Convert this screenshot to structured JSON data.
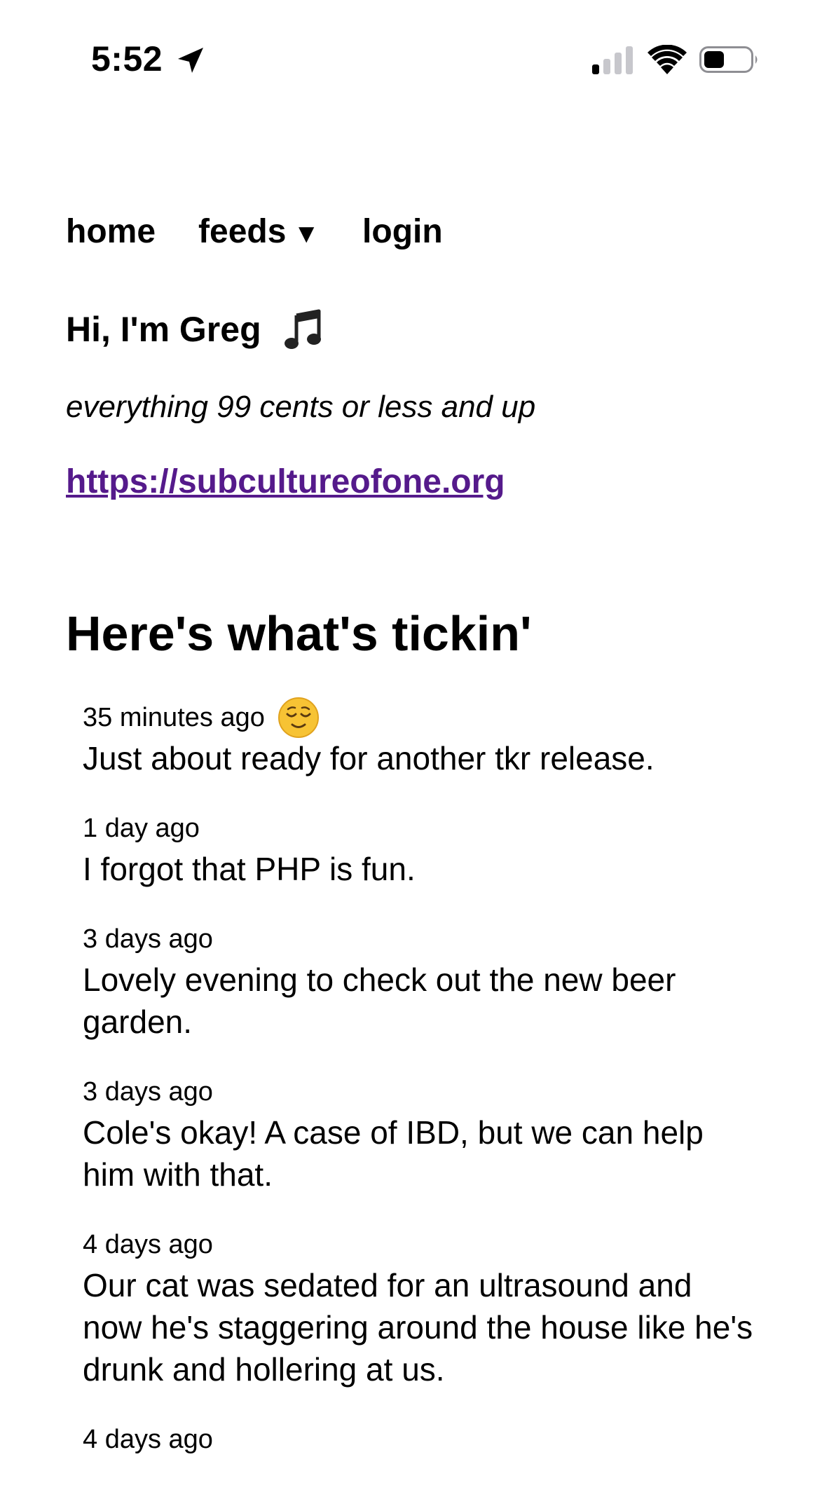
{
  "status_bar": {
    "time": "5:52",
    "icons": [
      "location-arrow-icon",
      "cellular-signal-icon",
      "wifi-icon",
      "battery-icon"
    ]
  },
  "nav": {
    "home": "home",
    "feeds": "feeds",
    "feeds_caret": "▼",
    "login": "login"
  },
  "profile": {
    "greeting": "Hi, I'm Greg",
    "greeting_icon": "music-note-icon",
    "tagline": "everything 99 cents or less and up",
    "homepage": "https://subcultureofone.org"
  },
  "feed": {
    "heading": "Here's what's tickin'",
    "items": [
      {
        "time": "35 minutes ago",
        "mood": "relieved-face-icon",
        "text": "Just about ready for another tkr release."
      },
      {
        "time": "1 day ago",
        "text": "I forgot that PHP is fun."
      },
      {
        "time": "3 days ago",
        "text": "Lovely evening to check out the new beer garden."
      },
      {
        "time": "3 days ago",
        "text": "Cole's okay! A case of IBD, but we can help him with that."
      },
      {
        "time": "4 days ago",
        "text": "Our cat was sedated for an ultrasound and now he's staggering around the house like he's drunk and hollering at us."
      },
      {
        "time": "4 days ago",
        "text": ""
      }
    ]
  },
  "colors": {
    "link_visited": "#551a8b",
    "text": "#000000",
    "background": "#ffffff",
    "mood_face": "#f7c334"
  }
}
